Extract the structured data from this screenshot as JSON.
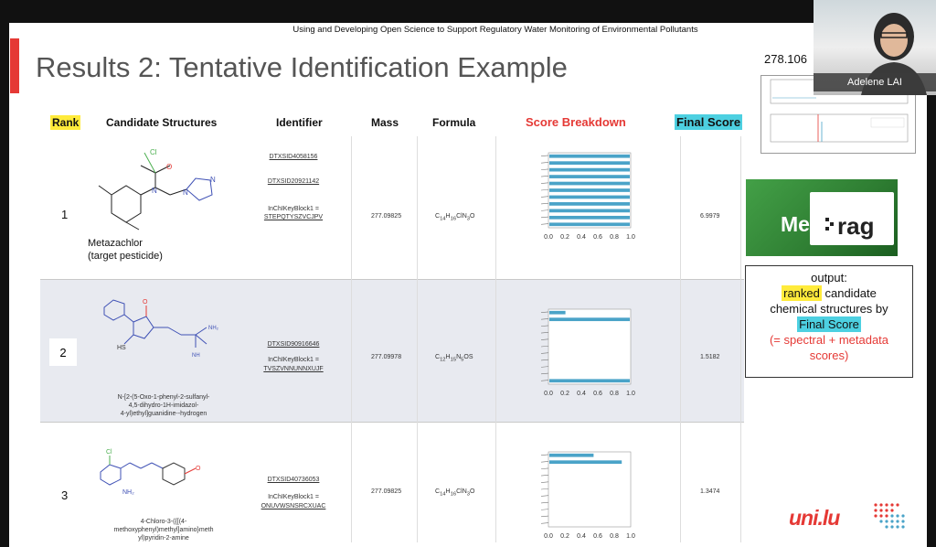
{
  "slide": {
    "top_caption": "Using and Developing Open Science to Support Regulatory Water Monitoring of Environmental Pollutants",
    "title": "Results 2: Tentative Identification Example"
  },
  "table": {
    "headers": {
      "rank": "Rank",
      "structures": "Candidate Structures",
      "identifier": "Identifier",
      "mass": "Mass",
      "formula": "Formula",
      "score_breakdown": "Score Breakdown",
      "final_score": "Final Score"
    },
    "rows": [
      {
        "rank": "1",
        "name_line1": "Metazachlor",
        "name_line2": "(target pesticide)",
        "id1": "DTXSID4058156",
        "id2": "DTXSID20921142",
        "inchi_label": "InChIKeyBlock1 =",
        "inchi": "STEPQTYSZVCJPV",
        "mass": "277.09825",
        "formula": "C14H16ClN3O",
        "final": "6.9979"
      },
      {
        "rank": "2",
        "name_line1": "N-[2-(5-Oxo-1-phenyl-2-sulfanyl-",
        "name_line2": "4,5-dihydro-1H-imidazol-",
        "name_line3": "4-yl)ethyl]guanidine--hydrogen",
        "id1": "DTXSID90916646",
        "inchi_label": "InChIKeyBlock1 =",
        "inchi": "TVSZVNNUNNXUJF",
        "mass": "277.09978",
        "formula": "C12H15N5OS",
        "final": "1.5182"
      },
      {
        "rank": "3",
        "name_line1": "4-Chloro-3-({[(4-",
        "name_line2": "methoxyphenyl)methyl]amino}meth",
        "name_line3": "yl)pyridin-2-amine",
        "id1": "DTXSID40736053",
        "inchi_label": "InChIKeyBlock1 =",
        "inchi": "ONUVWSNSRCXUAC",
        "mass": "277.09825",
        "formula": "C14H16ClN3O",
        "final": "1.3474"
      }
    ]
  },
  "chart_data": [
    {
      "type": "bar",
      "orientation": "horizontal",
      "x_ticks": [
        "0.0",
        "0.2",
        "0.4",
        "0.6",
        "0.8",
        "1.0"
      ],
      "values": [
        1.0,
        1.0,
        1.0,
        1.0,
        1.0,
        1.0,
        1.0,
        1.0,
        1.0,
        1.0,
        1.0
      ]
    },
    {
      "type": "bar",
      "orientation": "horizontal",
      "x_ticks": [
        "0.0",
        "0.2",
        "0.4",
        "0.6",
        "0.8",
        "1.0"
      ],
      "values": [
        0.2,
        1.0,
        0,
        0,
        0,
        0,
        0,
        0,
        0,
        0,
        1.0
      ]
    },
    {
      "type": "bar",
      "orientation": "horizontal",
      "x_ticks": [
        "0.0",
        "0.2",
        "0.4",
        "0.6",
        "0.8",
        "1.0"
      ],
      "values": [
        0.55,
        0.9,
        0,
        0,
        0,
        0,
        0,
        0,
        0,
        0,
        0
      ]
    }
  ],
  "right": {
    "mz_label": "278.106",
    "metfrag_met": "Met",
    "metfrag_frag": "rag",
    "out_line1": "output:",
    "out_ranked": "ranked",
    "out_line2_rest": " candidate",
    "out_line3": "chemical structures by",
    "out_final": "Final Score",
    "out_line5": "(= spectral + metadata",
    "out_line6": "scores)",
    "logo_uni": "uni.lu"
  },
  "webcam": {
    "name": "Adelene LAI"
  },
  "colors": {
    "bar": "#4aa3c8",
    "accent_red": "#e53935",
    "yellow": "#ffeb3b",
    "cyan": "#4dd0e1"
  }
}
